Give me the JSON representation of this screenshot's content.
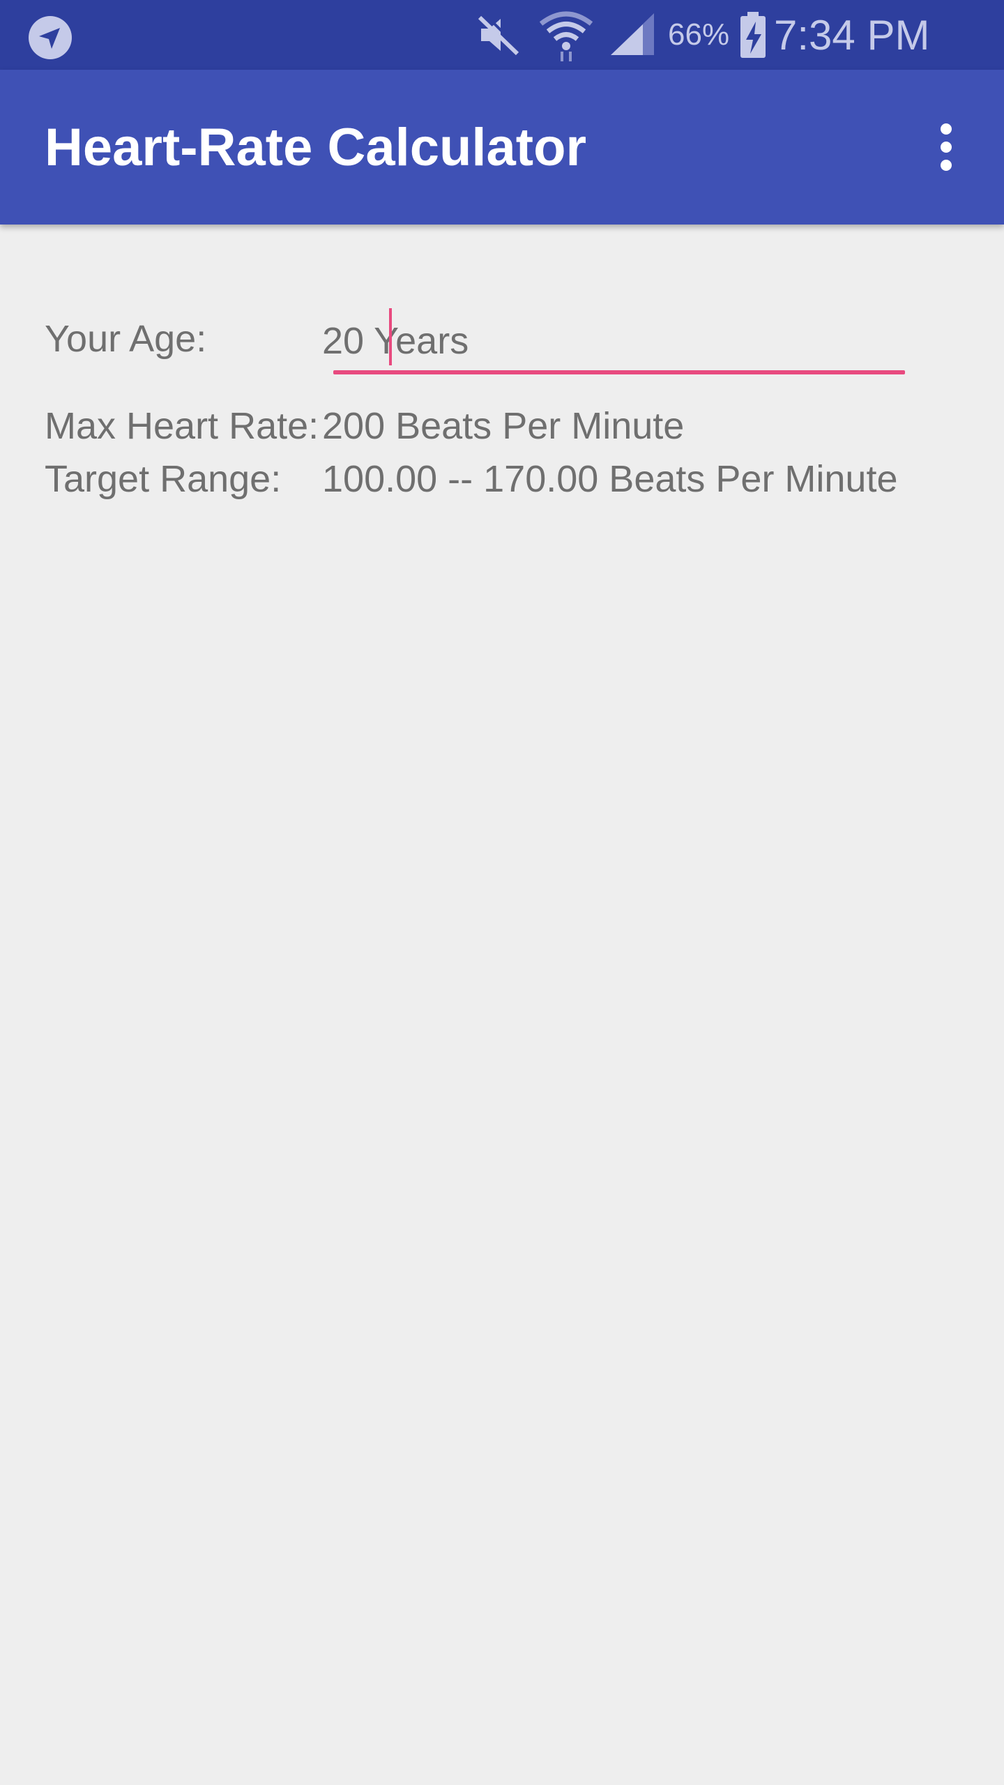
{
  "status_bar": {
    "battery_percent": "66%",
    "time": "7:34 PM",
    "icons": [
      "navigation-icon",
      "mute-icon",
      "wifi-icon",
      "signal-icon",
      "battery-charging-icon"
    ]
  },
  "app_bar": {
    "title": "Heart-Rate Calculator",
    "overflow_icon": "more-vert-icon"
  },
  "form": {
    "age_label": "Your Age:",
    "age_value": "20 Years",
    "max_heart_rate_label": "Max Heart Rate:",
    "max_heart_rate_value": "200 Beats Per Minute",
    "target_range_label": "Target Range:",
    "target_range_value": "100.00 -- 170.00 Beats Per Minute"
  },
  "colors": {
    "status_bar": "#2e3f9e",
    "app_bar": "#3f51b5",
    "accent": "#e84a7f",
    "background": "#eeeeee",
    "text": "#6f6f6f"
  }
}
